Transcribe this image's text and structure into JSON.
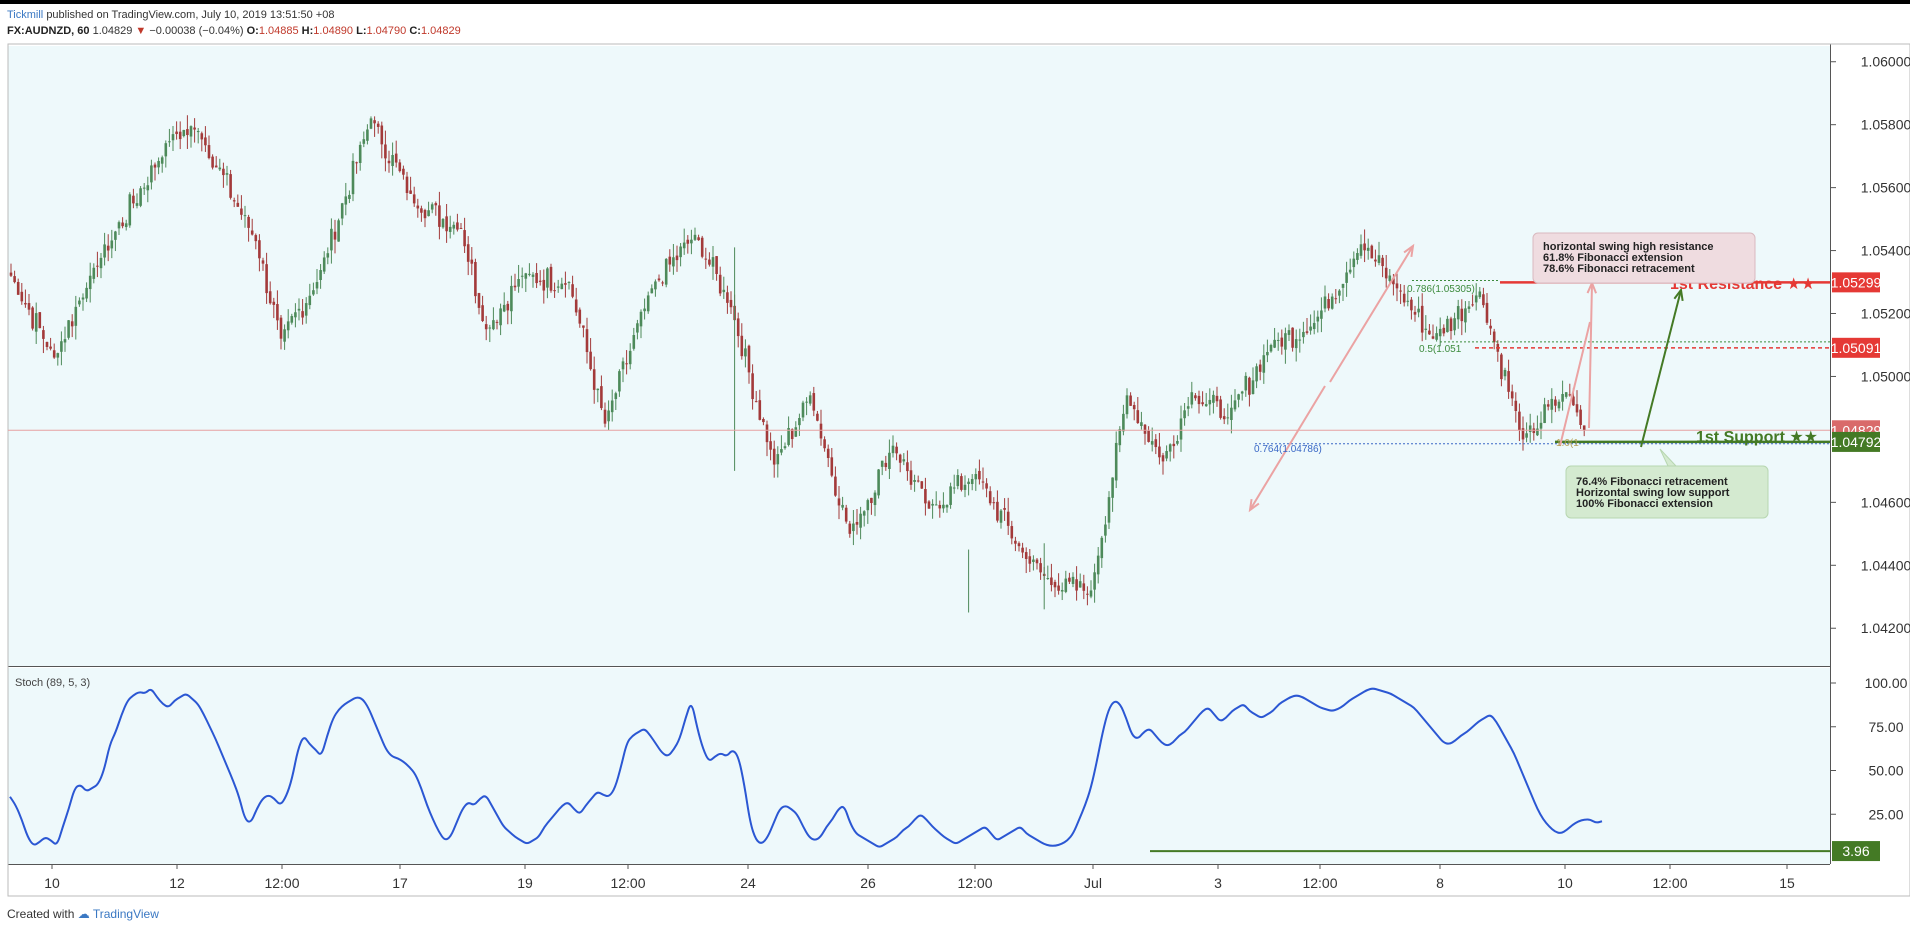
{
  "header": {
    "author": "Tickmill",
    "published_text": "published on TradingView.com, July 10, 2019 13:51:50 +08",
    "symbol": "FX:AUDNZD, 60",
    "last": "1.04829",
    "change": "−0.00038 (−0.04%)",
    "o_label": "O:",
    "o": "1.04885",
    "h_label": "H:",
    "h": "1.04890",
    "l_label": "L:",
    "l": "1.04790",
    "c_label": "C:",
    "c": "1.04829"
  },
  "footer": {
    "created_with": "Created with",
    "brand": "TradingView"
  },
  "colors": {
    "bg": "#eef9fb",
    "up": "#4d8a5a",
    "down": "#a33a3a",
    "resistance": "#e53935",
    "support": "#447a25",
    "stoch": "#2b57d3"
  },
  "chart_data": [
    {
      "type": "candlestick",
      "title": "FX:AUDNZD, 60",
      "x_ticks": [
        "10",
        "12",
        "12:00",
        "17",
        "19",
        "12:00",
        "24",
        "26",
        "12:00",
        "Jul",
        "3",
        "12:00",
        "8",
        "10",
        "12:00",
        "15"
      ],
      "y_ticks": [
        "1.06000",
        "1.05800",
        "1.05600",
        "1.05400",
        "1.05200",
        "1.05000",
        "1.04600",
        "1.04400",
        "1.04200"
      ],
      "ylim": [
        1.0408,
        1.0605
      ],
      "grid": false,
      "approx_swing_points": [
        {
          "i": 0,
          "price": 1.0532
        },
        {
          "i": 12,
          "price": 1.0506
        },
        {
          "i": 22,
          "price": 1.0532
        },
        {
          "i": 45,
          "price": 1.0577
        },
        {
          "i": 52,
          "price": 1.0578
        },
        {
          "i": 68,
          "price": 1.0543
        },
        {
          "i": 75,
          "price": 1.0512
        },
        {
          "i": 85,
          "price": 1.053
        },
        {
          "i": 100,
          "price": 1.0582
        },
        {
          "i": 112,
          "price": 1.0555
        },
        {
          "i": 125,
          "price": 1.0547
        },
        {
          "i": 132,
          "price": 1.0515
        },
        {
          "i": 142,
          "price": 1.0532
        },
        {
          "i": 155,
          "price": 1.053
        },
        {
          "i": 165,
          "price": 1.0485
        },
        {
          "i": 178,
          "price": 1.0528
        },
        {
          "i": 190,
          "price": 1.0545
        },
        {
          "i": 200,
          "price": 1.0522
        },
        {
          "i": 212,
          "price": 1.0472
        },
        {
          "i": 222,
          "price": 1.0494
        },
        {
          "i": 233,
          "price": 1.045
        },
        {
          "i": 245,
          "price": 1.0478
        },
        {
          "i": 255,
          "price": 1.0458
        },
        {
          "i": 268,
          "price": 1.0469
        },
        {
          "i": 282,
          "price": 1.0442
        },
        {
          "i": 290,
          "price": 1.0433
        },
        {
          "i": 300,
          "price": 1.0432
        },
        {
          "i": 310,
          "price": 1.0494
        },
        {
          "i": 320,
          "price": 1.0473
        },
        {
          "i": 328,
          "price": 1.0495
        },
        {
          "i": 338,
          "price": 1.0487
        },
        {
          "i": 350,
          "price": 1.051
        },
        {
          "i": 362,
          "price": 1.0517
        },
        {
          "i": 375,
          "price": 1.0542
        },
        {
          "i": 385,
          "price": 1.0528
        },
        {
          "i": 395,
          "price": 1.0512
        },
        {
          "i": 408,
          "price": 1.0527
        },
        {
          "i": 420,
          "price": 1.048
        },
        {
          "i": 432,
          "price": 1.0495
        },
        {
          "i": 437,
          "price": 1.0483
        }
      ],
      "levels": [
        {
          "name": "resistance",
          "price": 1.05299,
          "label": "1.05299"
        },
        {
          "name": "fib-0.5",
          "price": 1.05091,
          "label": "1.05091"
        },
        {
          "name": "last",
          "price": 1.04829,
          "label": "1.04829"
        },
        {
          "name": "support",
          "price": 1.04792,
          "label": "1.04792"
        }
      ],
      "annotations": {
        "resistance_label": "1st Resistance ★★",
        "support_label": "1st Support ★★",
        "fib_786": "0.786(1.05305)",
        "fib_05": "0.5(1.051",
        "fib_764": "0.764(1.04786)",
        "fib_100": "1.0(1",
        "resistance_box": [
          "horizontal swing high resistance",
          "61.8% Fibonacci extension",
          "78.6% Fibonacci retracement"
        ],
        "support_box": [
          "76.4% Fibonacci retracement",
          "Horizontal swing low support",
          "100% Fibonacci extension"
        ]
      }
    },
    {
      "type": "line",
      "title": "Stoch (89, 5, 3)",
      "y_ticks": [
        "100.00",
        "75.00",
        "50.00",
        "25.00"
      ],
      "ylim": [
        0,
        100
      ],
      "last_value": "3.96",
      "series": [
        {
          "values": [
            35,
            30,
            22,
            12,
            7,
            9,
            12,
            10,
            7,
            18,
            28,
            40,
            42,
            38,
            40,
            42,
            50,
            65,
            72,
            82,
            90,
            93,
            95,
            94,
            97,
            92,
            88,
            86,
            90,
            92,
            94,
            91,
            88,
            82,
            75,
            68,
            60,
            52,
            44,
            35,
            22,
            20,
            28,
            34,
            36,
            34,
            30,
            35,
            45,
            62,
            70,
            65,
            62,
            58,
            70,
            80,
            85,
            88,
            90,
            92,
            91,
            86,
            78,
            70,
            62,
            58,
            57,
            55,
            52,
            48,
            40,
            30,
            22,
            15,
            10,
            12,
            20,
            28,
            32,
            30,
            34,
            36,
            30,
            24,
            18,
            15,
            12,
            10,
            8,
            10,
            12,
            18,
            22,
            26,
            30,
            32,
            28,
            25,
            30,
            34,
            38,
            36,
            35,
            40,
            52,
            66,
            70,
            72,
            74,
            70,
            65,
            60,
            58,
            62,
            68,
            80,
            90,
            74,
            62,
            55,
            58,
            60,
            58,
            62,
            58,
            42,
            20,
            10,
            8,
            12,
            20,
            28,
            30,
            28,
            25,
            18,
            12,
            10,
            12,
            18,
            22,
            28,
            30,
            20,
            14,
            12,
            10,
            8,
            6,
            8,
            10,
            12,
            16,
            18,
            22,
            25,
            22,
            18,
            15,
            12,
            10,
            8,
            10,
            12,
            14,
            16,
            18,
            14,
            10,
            12,
            14,
            16,
            18,
            14,
            12,
            10,
            8,
            7,
            7,
            8,
            10,
            14,
            22,
            30,
            40,
            55,
            72,
            85,
            90,
            88,
            80,
            70,
            68,
            72,
            74,
            70,
            66,
            64,
            66,
            70,
            72,
            76,
            80,
            84,
            86,
            82,
            78,
            80,
            84,
            86,
            88,
            84,
            82,
            80,
            82,
            84,
            88,
            90,
            92,
            93,
            92,
            90,
            88,
            86,
            85,
            84,
            85,
            87,
            90,
            92,
            94,
            96,
            97,
            96,
            95,
            94,
            92,
            90,
            88,
            86,
            82,
            78,
            74,
            70,
            66,
            65,
            67,
            70,
            72,
            75,
            78,
            80,
            82,
            78,
            72,
            66,
            60,
            52,
            44,
            36,
            28,
            22,
            18,
            15,
            14,
            16,
            19,
            21,
            22,
            22,
            20,
            21
          ]
        }
      ],
      "reference_level": 3.96
    }
  ]
}
